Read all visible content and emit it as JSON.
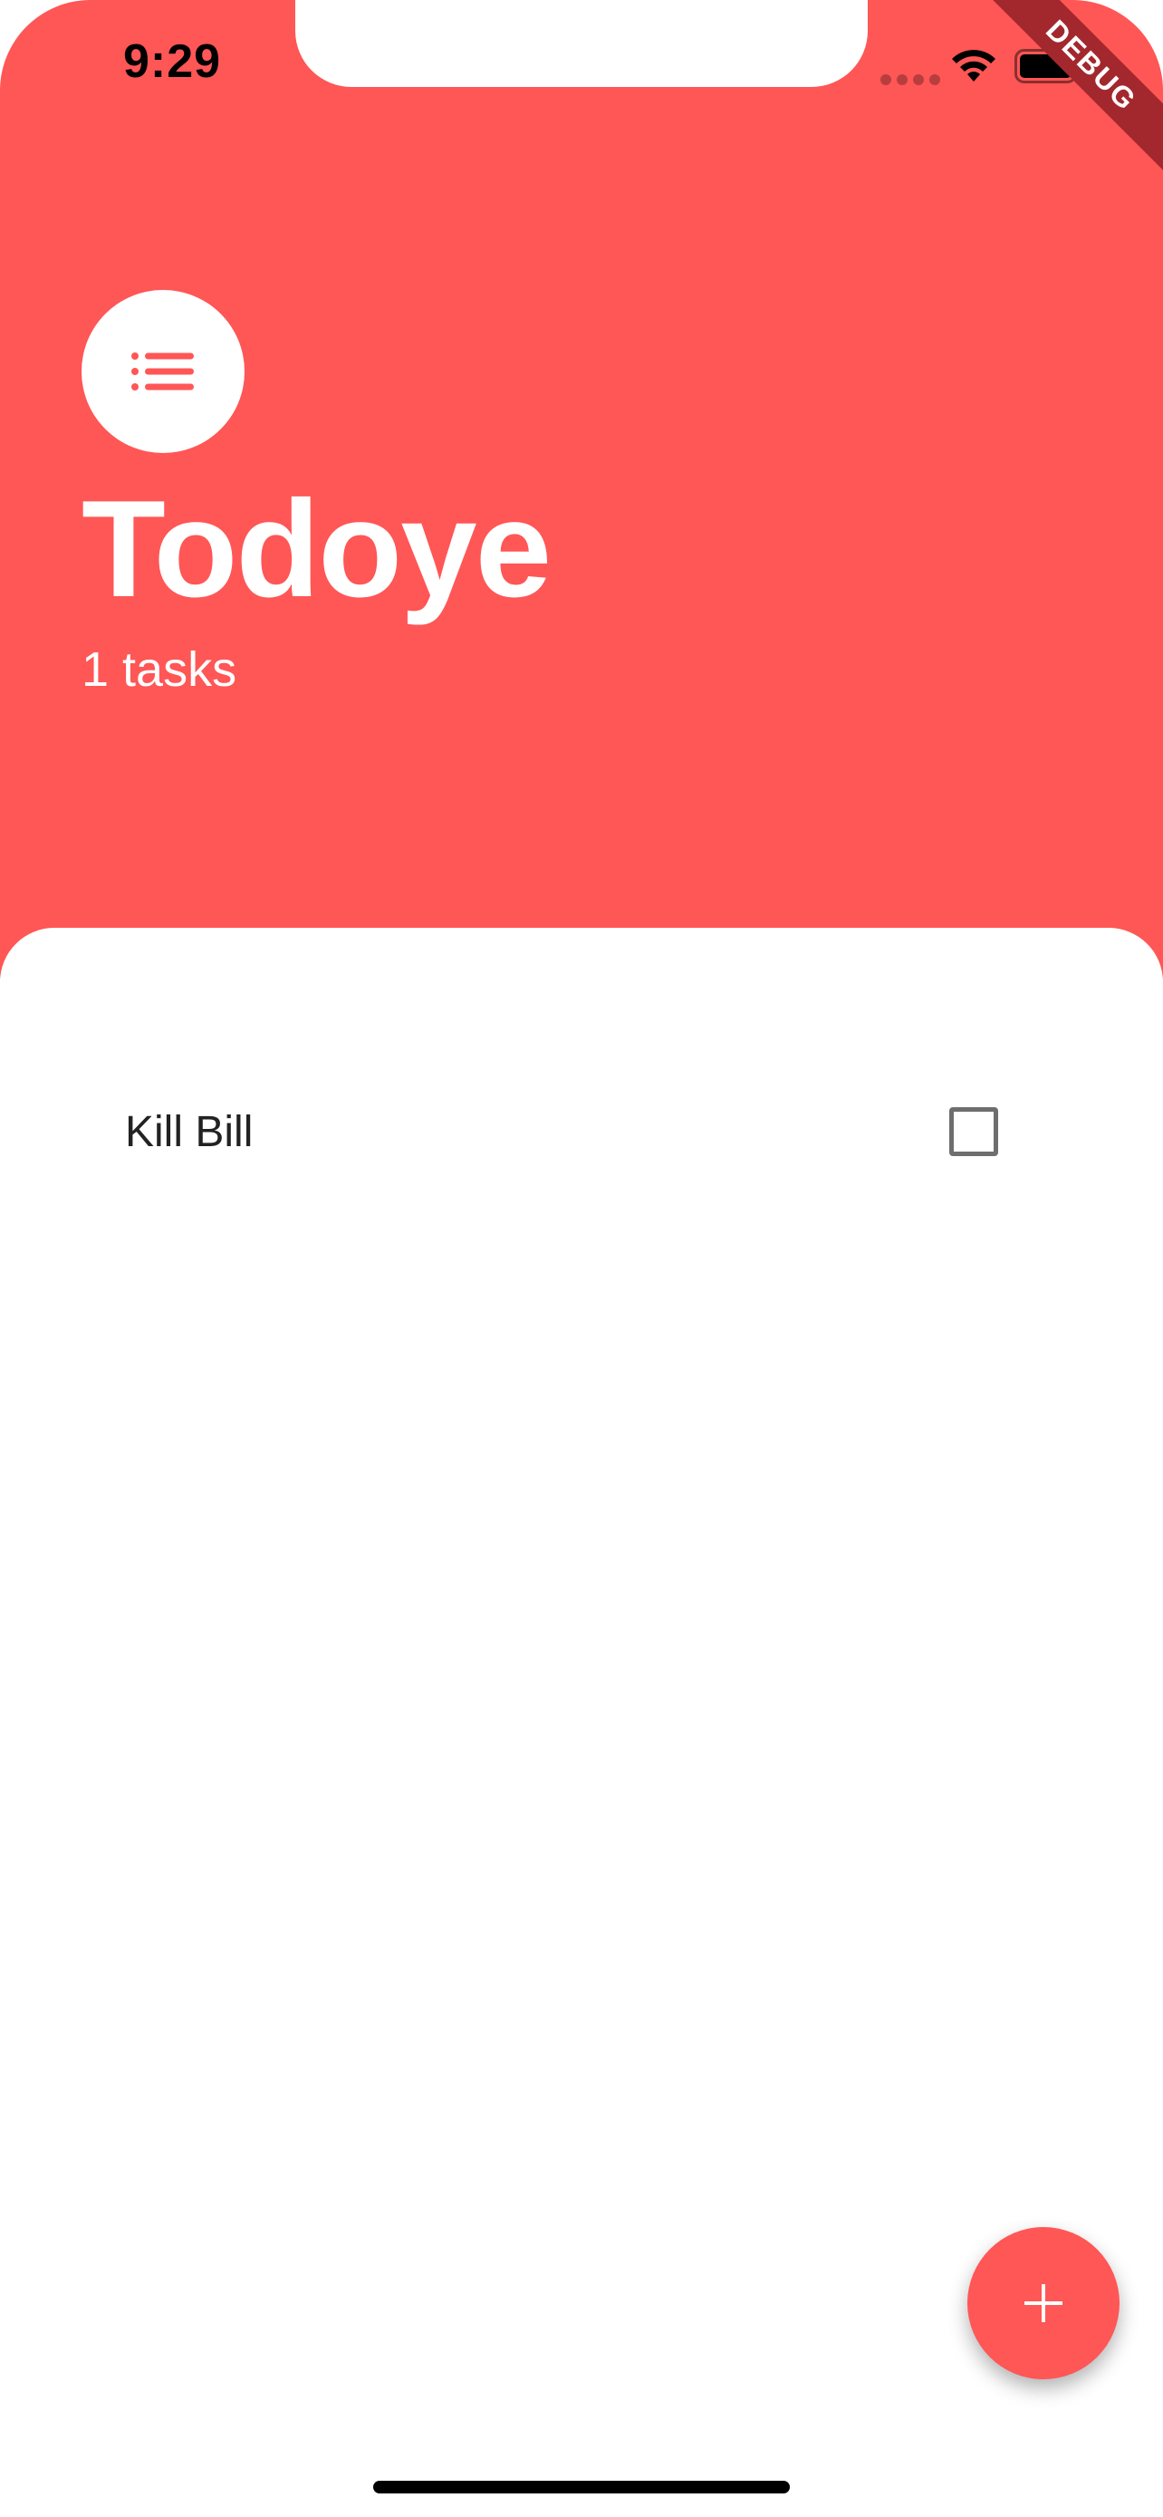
{
  "status_bar": {
    "time": "9:29",
    "icons": [
      "cellular-dots-icon",
      "wifi-icon",
      "battery-icon"
    ]
  },
  "debug_banner": {
    "label": "DEBUG"
  },
  "header": {
    "icon": "list-icon",
    "title": "Todoye",
    "task_count": "1 tasks"
  },
  "tasks": {
    "items": [
      {
        "label": "Kill Bill",
        "checked": false
      }
    ]
  },
  "fab": {
    "icon": "plus-icon"
  },
  "colors": {
    "accent": "#FF5656",
    "debug_ribbon": "#A3282E",
    "task_text": "#222222",
    "checkbox_border": "#6e6e6e"
  }
}
